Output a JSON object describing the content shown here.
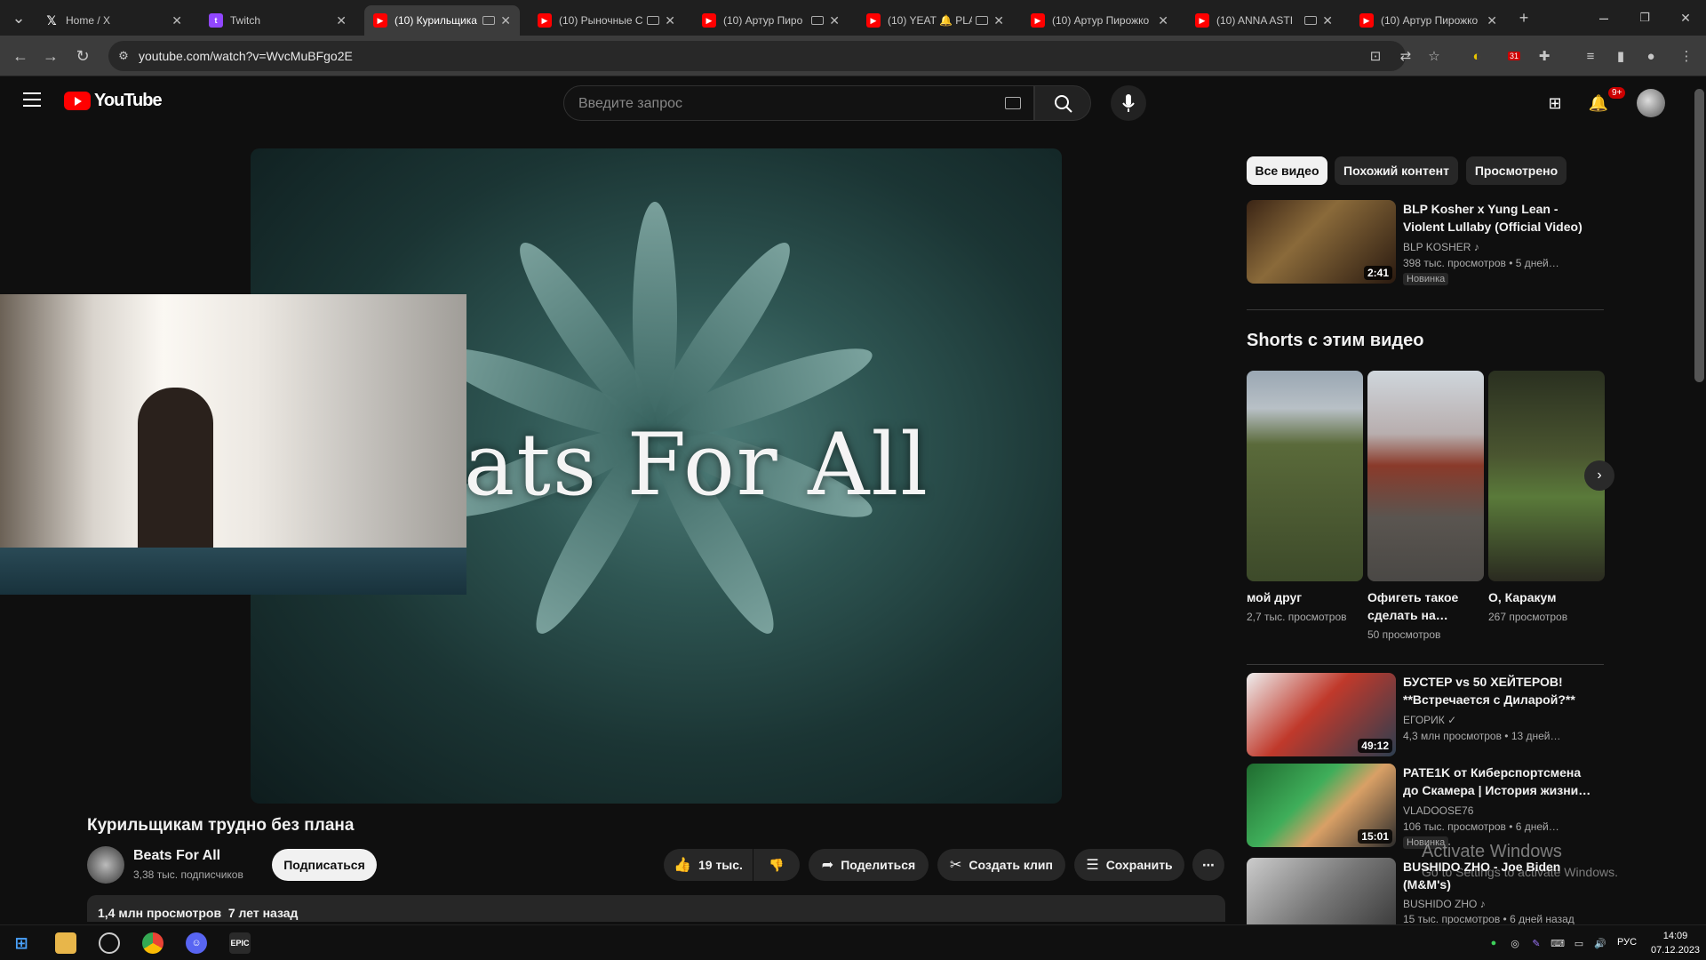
{
  "browser": {
    "tabs": [
      {
        "label": "Home / X",
        "favicon": "x-icon"
      },
      {
        "label": "Twitch",
        "favicon": "twitch-icon"
      },
      {
        "label": "(10) Курильщика",
        "favicon": "youtube-icon"
      },
      {
        "label": "(10) Рыночные С",
        "favicon": "youtube-icon"
      },
      {
        "label": "(10) Артур Пиро",
        "favicon": "youtube-icon"
      },
      {
        "label": "(10) YEAT 🔔 PLA",
        "favicon": "youtube-icon"
      },
      {
        "label": "(10) Артур Пирожко",
        "favicon": "youtube-icon"
      },
      {
        "label": "(10) ANNA ASTI",
        "favicon": "youtube-icon"
      },
      {
        "label": "(10) Артур Пирожко",
        "favicon": "youtube-icon"
      }
    ],
    "url": "youtube.com/watch?v=WvcMuBFgo2E",
    "ext_badge": "31"
  },
  "youtube": {
    "logo_text": "YouTube",
    "search_placeholder": "Введите запрос",
    "notifications_badge": "9+"
  },
  "video": {
    "overlay_title": "ats For All",
    "title": "Курильщикам трудно без плана",
    "channel": "Beats For All",
    "subscribers": "3,38 тыс. подписчиков",
    "subscribe_label": "Подписаться",
    "likes": "19 тыс.",
    "share_label": "Поделиться",
    "clip_label": "Создать клип",
    "save_label": "Сохранить",
    "views": "1,4 млн просмотров",
    "age": "7 лет назад"
  },
  "sidebar": {
    "chips": [
      "Все видео",
      "Похожий контент",
      "Просмотрено"
    ],
    "recs_top": [
      {
        "title": "BLP Kosher x Yung Lean - Violent Lullaby (Official Video)",
        "channel": "BLP KOSHER ♪",
        "meta": "398 тыс. просмотров • 5 дней…",
        "badge": "Новинка",
        "duration": "2:41"
      }
    ],
    "shorts_heading": "Shorts с этим видео",
    "shorts": [
      {
        "title": "мой друг",
        "views": "2,7 тыс. просмотров"
      },
      {
        "title": "Офигеть такое сделать на…",
        "views": "50 просмотров"
      },
      {
        "title": "О, Каракум",
        "views": "267 просмотров"
      }
    ],
    "recs_bottom": [
      {
        "title": "БУСТЕР vs 50 ХЕЙТЕРОВ! **Встречается с Диларой?**",
        "channel": "ЕГОРИК ✓",
        "meta": "4,3 млн просмотров • 13 дней…",
        "badge": "",
        "duration": "49:12"
      },
      {
        "title": "PATE1K от Киберспортсмена до Скамера | История жизни…",
        "channel": "VLADOOSE76",
        "meta": "106 тыс. просмотров • 6 дней…",
        "badge": "Новинка",
        "duration": "15:01"
      },
      {
        "title": "BUSHIDO ZHO - Joe Biden (M&M's)",
        "channel": "BUSHIDO ZHO ♪",
        "meta": "15 тыс. просмотров • 6 дней назад",
        "badge": "",
        "duration": ""
      }
    ]
  },
  "watermark": {
    "line1": "Activate Windows",
    "line2": "Go to Settings to activate Windows."
  },
  "taskbar": {
    "lang": "РУС",
    "time": "14:09",
    "date": "07.12.2023"
  },
  "colors": {
    "accent_red": "#ff0000",
    "background": "#0f0f0f"
  }
}
